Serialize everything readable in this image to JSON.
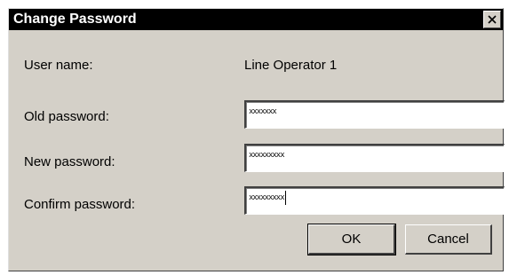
{
  "dialog": {
    "title": "Change Password",
    "close_icon": "close-icon"
  },
  "fields": {
    "user_name_label": "User name:",
    "user_name_value": "Line Operator 1",
    "old_password_label": "Old password:",
    "old_password_value": "xxxxxxx",
    "new_password_label": "New password:",
    "new_password_value": "xxxxxxxxx",
    "confirm_password_label": "Confirm password:",
    "confirm_password_value": "xxxxxxxxx"
  },
  "buttons": {
    "ok_label": "OK",
    "cancel_label": "Cancel"
  },
  "colors": {
    "titlebar": "#000000",
    "title_text": "#ffffff",
    "dialog_face": "#d4d0c8"
  }
}
